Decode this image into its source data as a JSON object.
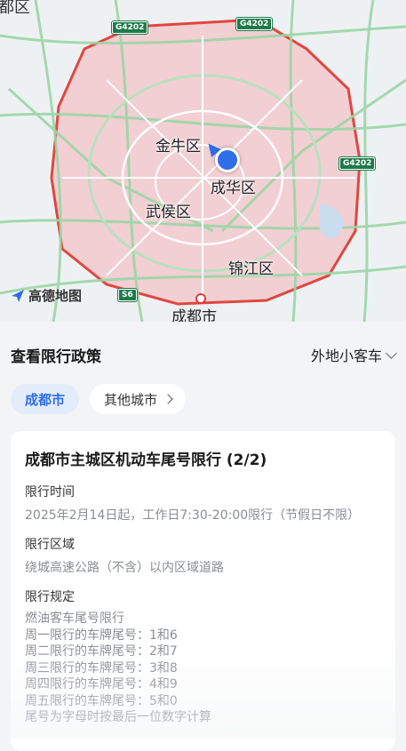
{
  "map": {
    "corner_label": "都区",
    "road_badges": [
      "G4202",
      "G4202",
      "G4202"
    ],
    "districts": [
      "金牛区",
      "成华区",
      "武侯区",
      "锦江区"
    ],
    "ring_road_badge": "S6",
    "city_center": "成都市",
    "logo_text": "高德地图",
    "colors": {
      "restriction_zone": "#f3c7cb",
      "zone_border": "#e0473f",
      "roads": "#9bd6a6",
      "location": "#2f6ee6"
    }
  },
  "sheet": {
    "title": "查看限行政策",
    "vehicle_type": "外地小客车",
    "chips": {
      "current_city": "成都市",
      "other_cities": "其他城市"
    }
  },
  "card": {
    "title": "成都市主城区机动车尾号限行 (2/2)",
    "time_label": "限行时间",
    "time_text": "2025年2月14日起，工作日7:30-20:00限行（节假日不限）",
    "area_label": "限行区域",
    "area_text": "绕城高速公路（不含）以内区域道路",
    "rule_label": "限行规定",
    "rules": [
      "燃油客车尾号限行",
      "周一限行的车牌尾号：1和6",
      "周二限行的车牌尾号：2和7",
      "周三限行的车牌尾号：3和8",
      "周四限行的车牌尾号：4和9",
      "周五限行的车牌尾号：5和0",
      "尾号为字母时按最后一位数字计算"
    ]
  }
}
